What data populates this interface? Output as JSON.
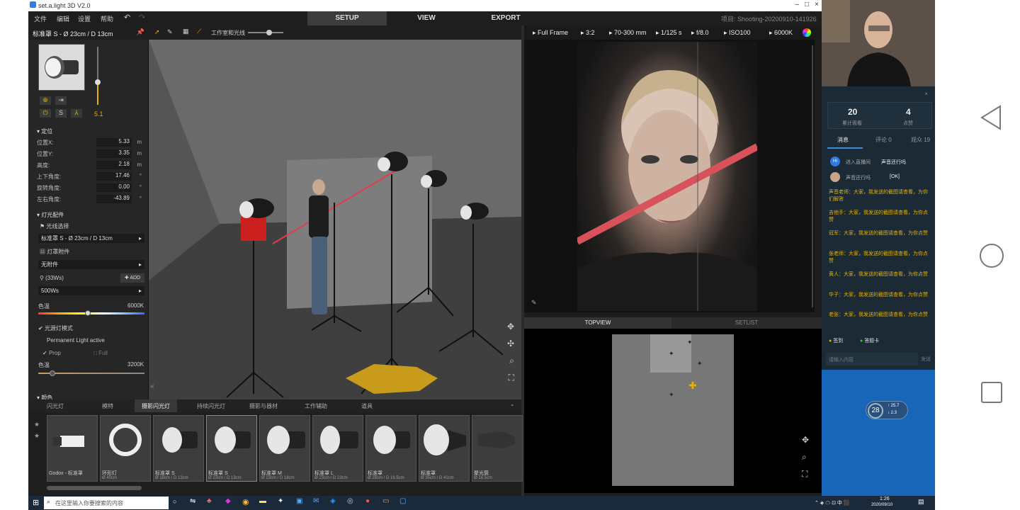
{
  "window": {
    "title": "set.a.light 3D V2.0",
    "project": "项目: Shooting-20200910-141926"
  },
  "menu": [
    "文件",
    "编辑",
    "设置",
    "帮助"
  ],
  "modes": [
    "SETUP",
    "VIEW",
    "EXPORT"
  ],
  "left": {
    "light_title": "标准罩 S - Ø 23cm / D 13cm",
    "power_value": "5.1",
    "sec_position": "定位",
    "props": [
      {
        "label": "位置X:",
        "value": "5.33",
        "unit": "m"
      },
      {
        "label": "位置Y:",
        "value": "3.35",
        "unit": "m"
      },
      {
        "label": "高度:",
        "value": "2.18",
        "unit": "m"
      },
      {
        "label": "上下角度:",
        "value": "17.46",
        "unit": "°"
      },
      {
        "label": "旋转角度:",
        "value": "0.00",
        "unit": "°"
      },
      {
        "label": "左右角度:",
        "value": "-43.89",
        "unit": "°"
      }
    ],
    "sec_light": "灯光配件",
    "modifier_label": "光线选择",
    "modifier_value": "标准罩 S - Ø 23cm / D 13cm",
    "sec_gel": "灯罩附件",
    "gel_value": "无附件",
    "watt_label": "(33Ws)",
    "add_label": "ADD",
    "watt_value": "500Ws",
    "color_label": "色温",
    "color_value": "6000K",
    "check_label": "光源灯模式",
    "perm_label": "Permanent Light active",
    "prop_label": "Prop",
    "full_label": "Full",
    "temp2_label": "色温",
    "temp2_value": "3200K",
    "sec_more": "颜色"
  },
  "viewport": {
    "toolbar_label": "工作室和光线"
  },
  "camera": {
    "body": "Full Frame",
    "ratio": "3:2",
    "lens": "70-300 mm",
    "shutter": "1/125 s",
    "aperture": "f/8.0",
    "iso": "ISO100",
    "wb": "6000K"
  },
  "panels": {
    "topview": "TOPVIEW",
    "setlist": "SETLIST"
  },
  "bottom_tabs": [
    "闪光灯",
    "模特",
    "摄影闪光灯",
    "持续闪光灯",
    "摄影与器材",
    "工作辅助",
    "道具"
  ],
  "shelf": [
    {
      "name": "Godox - 标准罩",
      "size": ""
    },
    {
      "name": "环形灯",
      "size": "Ø 40cm"
    },
    {
      "name": "标准罩 S",
      "size": "Ø 18cm / D 13cm"
    },
    {
      "name": "标准罩 S",
      "size": "Ø 23cm / D 13cm"
    },
    {
      "name": "标准罩 M",
      "size": "Ø 23cm / D 18cm"
    },
    {
      "name": "标准罩 L",
      "size": "Ø 23cm / D 23cm"
    },
    {
      "name": "标准罩",
      "size": "Ø 28cm / D 16.5cm"
    },
    {
      "name": "标准罩",
      "size": "Ø 35cm / D 41cm"
    },
    {
      "name": "聚光筒",
      "size": "Ø 16.5cm"
    }
  ],
  "chat": {
    "stats": [
      {
        "value": "20",
        "label": "累计观看"
      },
      {
        "value": "4",
        "label": "点赞"
      }
    ],
    "tabs": [
      "消息",
      "评论 0",
      "观众 19"
    ],
    "system": [
      {
        "name": "进入直播间",
        "text": "声音还行吗"
      },
      {
        "name": "声音还行吗",
        "text": "[OK]"
      }
    ],
    "messages": [
      "声音老师：大家，我发送的截图请查看，为你们解答",
      "吉他手：大家，我发送的截图请查看，为你点赞",
      "冠军：大家，我发送的截图请查看，为你点赞",
      "张老师：大家，我发送的截图请查看，为你点赞",
      "黄人：大家，我发送的截图请查看，为你点赞",
      "华子：大家，我发送的截图请查看，为你点赞",
      "老张：大家，我发送的截图请查看，为你点赞"
    ],
    "sign": "签到",
    "gift": "答题卡",
    "input_placeholder": "请输入内容",
    "send": "发送"
  },
  "weather": {
    "temp": "28",
    "unit": "°C",
    "up": "↑ 25.7",
    "down": "↓ 2.3"
  },
  "taskbar": {
    "search": "在这里输入你要搜索的内容",
    "time": "1:26",
    "date": "2020/09/10"
  }
}
